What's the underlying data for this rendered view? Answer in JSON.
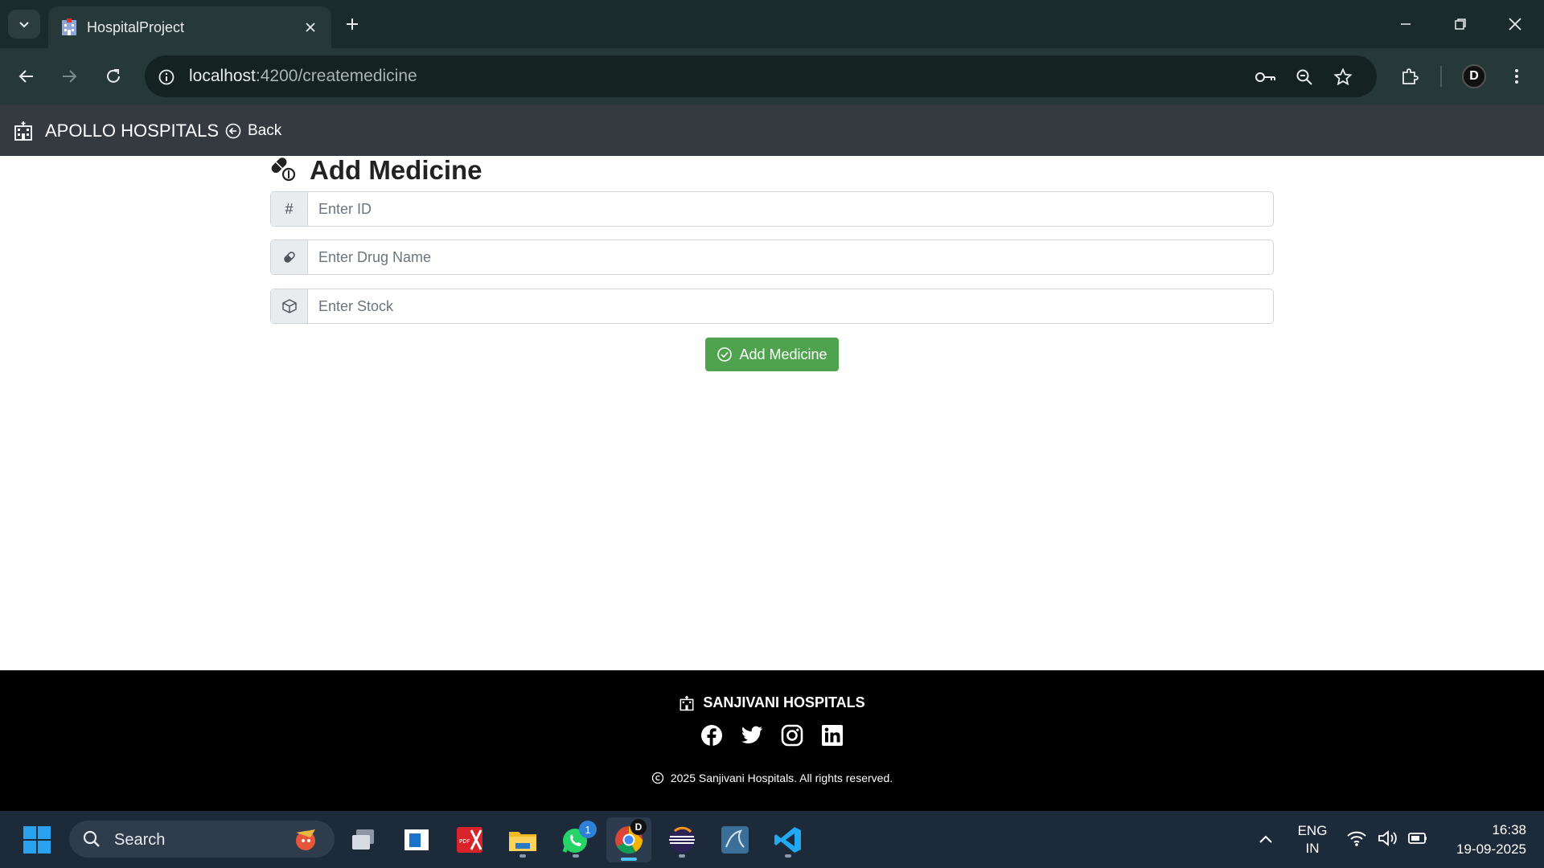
{
  "browser": {
    "tab_title": "HospitalProject",
    "url_host": "localhost",
    "url_rest": ":4200/createmedicine",
    "profile_initial": "D"
  },
  "navbar": {
    "brand": "APOLLO HOSPITALS",
    "back_label": "Back"
  },
  "form": {
    "title": "Add Medicine",
    "id_addon": "#",
    "id_placeholder": "Enter ID",
    "drug_placeholder": "Enter Drug Name",
    "stock_placeholder": "Enter Stock",
    "submit_label": "Add Medicine",
    "accent_color": "#4fa34f"
  },
  "footer": {
    "brand": "SANJIVANI HOSPITALS",
    "social": [
      "facebook-icon",
      "twitter-icon",
      "instagram-icon",
      "linkedin-icon"
    ],
    "copyright": "2025 Sanjivani Hospitals. All rights reserved."
  },
  "taskbar": {
    "search_label": "Search",
    "whatsapp_badge": "1",
    "lang_top": "ENG",
    "lang_bottom": "IN",
    "time": "16:38",
    "date": "19-09-2025"
  }
}
